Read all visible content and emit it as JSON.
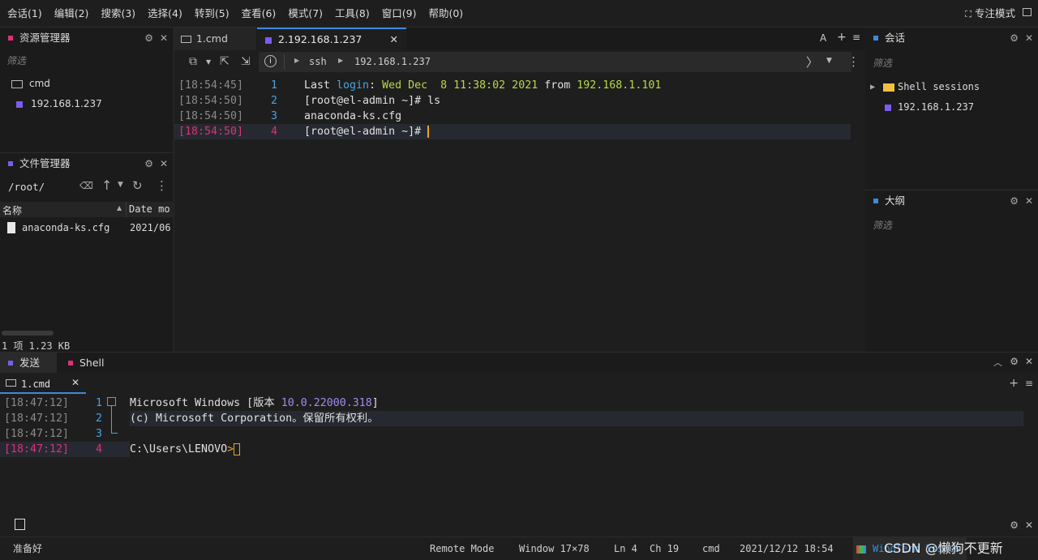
{
  "menu": [
    "会话(1)",
    "编辑(2)",
    "搜索(3)",
    "选择(4)",
    "转到(5)",
    "查看(6)",
    "模式(7)",
    "工具(8)",
    "窗口(9)",
    "帮助(0)"
  ],
  "focus_mode": "专注模式",
  "resource_manager": {
    "title": "资源管理器",
    "filter": "筛选",
    "items": [
      "cmd",
      "192.168.1.237"
    ]
  },
  "file_manager": {
    "title": "文件管理器",
    "path": "/root/",
    "col_name": "名称",
    "col_date": "Date mo",
    "files": [
      {
        "name": "anaconda-ks.cfg",
        "date": "2021/06"
      }
    ],
    "footer": "1 项 1.23 KB"
  },
  "main_tabs": [
    {
      "label": "1.cmd"
    },
    {
      "label": "2.192.168.1.237",
      "active": true
    }
  ],
  "tab_tools": {
    "font": "A",
    "plus": "+",
    "menu": "≡"
  },
  "toolbar": {
    "ssh": "ssh",
    "host": "192.168.1.237"
  },
  "ssh_terminal": [
    {
      "ts": "[18:54:45]",
      "ln": "1",
      "parts": [
        [
          "Last ",
          "#e0e0e0"
        ],
        [
          "login",
          "#4aa3df"
        ],
        [
          ": ",
          "#e0e0e0"
        ],
        [
          "Wed Dec  8 11:38:02 2021",
          "#b8d84a"
        ],
        [
          " from ",
          "#e0e0e0"
        ],
        [
          "192.168.1.101",
          "#b8d84a"
        ]
      ]
    },
    {
      "ts": "[18:54:50]",
      "ln": "2",
      "parts": [
        [
          "[root@el-admin ~]# ls",
          "#e0e0e0"
        ]
      ]
    },
    {
      "ts": "[18:54:50]",
      "ln": "3",
      "parts": [
        [
          "anaconda-ks.cfg",
          "#e0e0e0"
        ]
      ]
    },
    {
      "ts": "[18:54:50]",
      "ln": "4",
      "parts": [
        [
          "[root@el-admin ~]# ",
          "#e0e0e0"
        ]
      ],
      "current": true
    }
  ],
  "sessions": {
    "title": "会话",
    "filter": "筛选",
    "folder": "Shell sessions",
    "item": "192.168.1.237"
  },
  "outline": {
    "title": "大纲",
    "filter": "筛选"
  },
  "bottom_tabs": [
    {
      "label": "发送"
    },
    {
      "label": "Shell"
    }
  ],
  "bottom_subtab": "1.cmd",
  "cmd_terminal": [
    {
      "ts": "[18:47:12]",
      "ln": "1",
      "parts": [
        [
          "Microsoft Windows [版本 ",
          "#e0e0e0"
        ],
        [
          "10.0.22000.318",
          "#a08cf0"
        ],
        [
          "]",
          "#e0e0e0"
        ]
      ]
    },
    {
      "ts": "[18:47:12]",
      "ln": "2",
      "parts": [
        [
          "(c) Microsoft Corporation。保留所有权利。",
          "#e0e0e0"
        ]
      ],
      "highlight": true
    },
    {
      "ts": "[18:47:12]",
      "ln": "3",
      "parts": []
    },
    {
      "ts": "[18:47:12]",
      "ln": "4",
      "parts": [
        [
          "C:\\Users\\LENOVO",
          "#e0e0e0"
        ],
        [
          ">",
          "#f0a020"
        ]
      ],
      "current": true
    }
  ],
  "status": {
    "ready": "准备好",
    "mode": "Remote Mode",
    "window": "Window 17×78",
    "ln": "Ln 4",
    "ch": "Ch 19",
    "shell": "cmd",
    "datetime": "2021/12/12 18:54",
    "brand": "WindTerm Issues",
    "watermark": "CSDN @懒狗不更新"
  },
  "colors": {
    "accent": "#3c8bd9",
    "session": "#7b5cf0",
    "pink": "#e0307a",
    "current_ts": "#e0307a"
  }
}
